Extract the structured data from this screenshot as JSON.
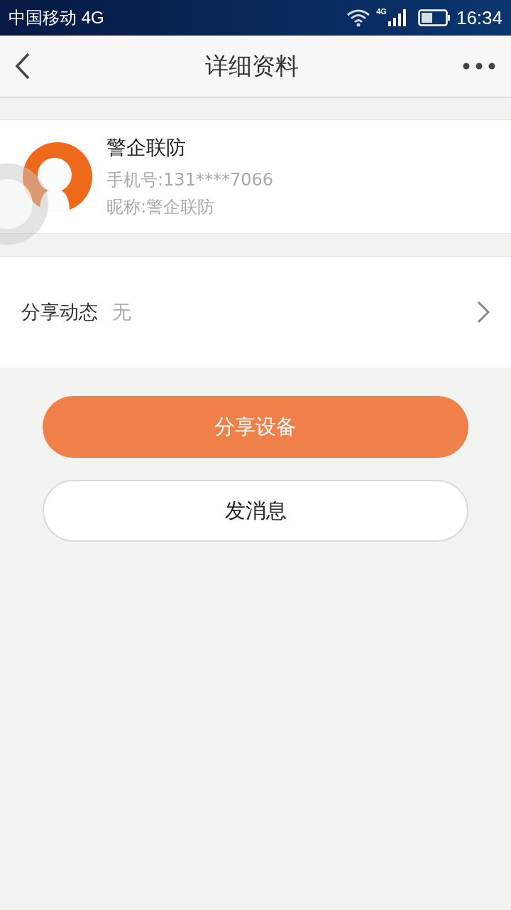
{
  "status_bar": {
    "carrier": "中国移动 4G",
    "network": "4G",
    "time": "16:34"
  },
  "nav": {
    "title": "详细资料"
  },
  "profile": {
    "name": "警企联防",
    "phone": "手机号:131****7066",
    "nickname": "昵称:警企联防"
  },
  "share_row": {
    "label": "分享动态",
    "value": "无"
  },
  "buttons": [
    {
      "label": "分享设备",
      "kind": "primary"
    },
    {
      "label": "发消息",
      "kind": "secondary"
    }
  ]
}
